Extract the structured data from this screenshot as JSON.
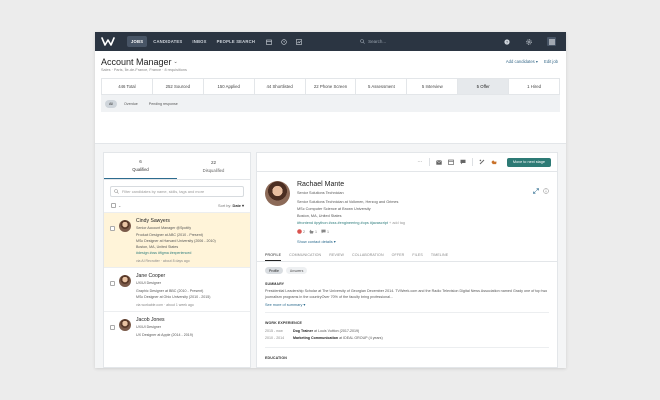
{
  "nav": {
    "items": [
      "JOBS",
      "CANDIDATES",
      "INBOX",
      "PEOPLE SEARCH"
    ],
    "active_index": 0,
    "search_placeholder": "Search..."
  },
  "job": {
    "title": "Account Manager",
    "meta": "Sales · Paris, Île-de-France, France · 8 requisitions",
    "add_candidates": "Add candidates ▾",
    "edit_job": "Edit job"
  },
  "pipeline": [
    {
      "label": "446 Total"
    },
    {
      "label": "252 Sourced"
    },
    {
      "label": "150 Applied"
    },
    {
      "label": "44 Shortlisted"
    },
    {
      "label": "22 Phone Screen"
    },
    {
      "label": "5 Assessment"
    },
    {
      "label": "5 Interview"
    },
    {
      "label": "5 Offer",
      "active": true
    },
    {
      "label": "1 Hired"
    }
  ],
  "filters": {
    "all": "All",
    "overdue": "Overdue",
    "pending": "Pending response"
  },
  "left": {
    "qualified_count": "6",
    "qualified_label": "Qualified",
    "disqualified_count": "22",
    "disqualified_label": "Disqualified",
    "filter_placeholder": "Filter candidates by name, skills, tags and more",
    "sort_label": "Sort by:",
    "sort_value": "Date ▾"
  },
  "candidates": [
    {
      "name": "Cindy Sawyers",
      "title": "Senior Account Manager @Spotify",
      "edu": "Product Designer at ABC (2010 - Present)",
      "school": "MSc Designer at Harvard University (2006 - 2010)",
      "location": "Boston, MA, United States",
      "tags": "#design  #css  #figma  #experienced",
      "time": "via AI Recruiter · about 8 days ago"
    },
    {
      "name": "Jane Cooper",
      "title": "UX/UI Designer",
      "edu": "Graphic Designer at BBC (2010 - Present)",
      "school": "MSc Designer at Ohio University (2010 - 2015)",
      "location": "",
      "tags": "",
      "time": "via workable.com · about 1 week ago"
    },
    {
      "name": "Jacob Jones",
      "title": "UX/UI Designer",
      "edu": "UX Designer at Apple (2014 - 2019)",
      "school": "",
      "location": "",
      "tags": "",
      "time": ""
    }
  ],
  "profile": {
    "move_button": "Move to next stage",
    "name": "Rachael Mante",
    "headline": "Senior Solutions Technician",
    "current": "Senior Solutions Technician at Volkmen, Herzog and Grimes",
    "education": "MSc Computer Science at Brown University",
    "location": "Boston, MA, United States",
    "tags": "#frontend  #python  #css  #engineering  #ops  #javascript",
    "add_tag": "+ add tag",
    "reactions": [
      "2",
      "1",
      "1"
    ],
    "contact_link": "Show contact details ▾",
    "tabs": [
      "PROFILE",
      "COMMUNICATION",
      "REVIEW",
      "COLLABORATION",
      "OFFER",
      "FILES",
      "TIMELINE"
    ],
    "subtabs": [
      "Profile",
      "Answers"
    ],
    "summary_title": "SUMMARY",
    "summary_text": "Presidential Leadership Scholar at The University of Georgian December 2014. TVWeek.com and the Radio Television Digital News Association named Grady one of top two journalism programs in the countryOver 70% of the faculty bring professional...",
    "summary_more": "See more of summary ▾",
    "work_title": "WORK EXPERIENCE",
    "work": [
      {
        "years": "2015 - now",
        "role": "Dog Trainer",
        "org": "at Louis Vuitton (2017-2019)"
      },
      {
        "years": "2010 - 2014",
        "role": "Marketing Communication",
        "org": "at IDEAL GROUP (4 years)"
      }
    ],
    "education_title": "EDUCATION"
  }
}
